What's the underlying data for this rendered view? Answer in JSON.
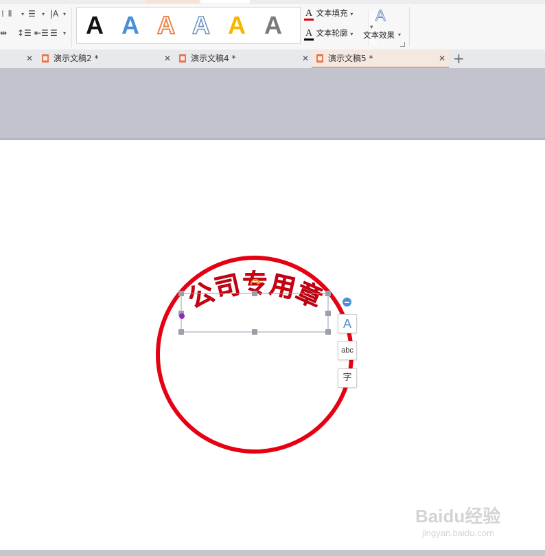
{
  "ribbon": {
    "art_styles": [
      {
        "letter": "A",
        "color": "#111111",
        "style": "solid-black"
      },
      {
        "letter": "A",
        "color": "#4a8fd6",
        "style": "blue-gradient"
      },
      {
        "letter": "A",
        "color": "#e8864e",
        "style": "orange-outline"
      },
      {
        "letter": "A",
        "color": "#6a8fc2",
        "style": "blue-outline"
      },
      {
        "letter": "A",
        "color": "#f5b800",
        "style": "gold"
      },
      {
        "letter": "A",
        "color": "#808080",
        "style": "gray-gradient"
      }
    ],
    "text_fill_label": "文本填充",
    "text_outline_label": "文本轮廓",
    "text_effect_label": "文本效果",
    "fill_color": "#e00000",
    "outline_color": "#000000"
  },
  "tabs": [
    {
      "label": "演示文稿2 *",
      "active": false
    },
    {
      "label": "演示文稿4 *",
      "active": false
    },
    {
      "label": "演示文稿5 *",
      "active": true
    }
  ],
  "slide": {
    "seal_text": "公司专用章",
    "seal_color": "#e60012"
  },
  "float_buttons": {
    "style_glyph": "A",
    "format_glyph": "abc",
    "font_glyph": "字"
  },
  "watermark": {
    "brand": "Baidu经验",
    "url": "jingyan.baidu.com"
  }
}
